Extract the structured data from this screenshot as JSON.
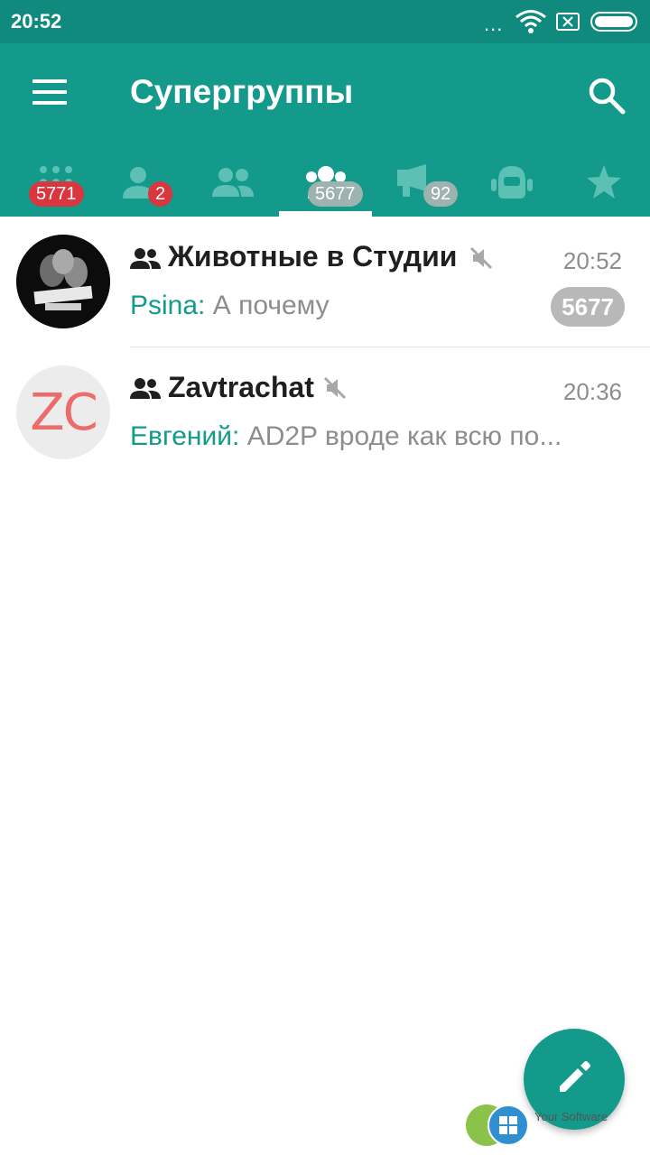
{
  "status_bar": {
    "time": "20:52",
    "dots": "..."
  },
  "app_bar": {
    "title": "Супергруппы"
  },
  "tabs": [
    {
      "icon": "all-chats-grid-icon",
      "badge": "5771",
      "badge_color": "#d9363e"
    },
    {
      "icon": "person-icon",
      "badge": "2",
      "badge_color": "#d9363e"
    },
    {
      "icon": "groups-icon",
      "badge": "",
      "badge_color": ""
    },
    {
      "icon": "supergroups-icon",
      "badge": "5677",
      "badge_color": "#9eb3b0",
      "selected": true
    },
    {
      "icon": "megaphone-icon",
      "badge": "92",
      "badge_color": "#9eb3b0"
    },
    {
      "icon": "bot-icon",
      "badge": "",
      "badge_color": ""
    },
    {
      "icon": "star-icon",
      "badge": "",
      "badge_color": ""
    }
  ],
  "chats": [
    {
      "name": "Животные в Студии",
      "time": "20:52",
      "sender": "Psina:",
      "message": "А почему",
      "unread": "5677",
      "muted": true
    },
    {
      "name": "Zavtrachat",
      "avatar_text": "ZC",
      "time": "20:36",
      "sender": "Евгений:",
      "message": "AD2P вроде как всю по...",
      "muted": true
    }
  ],
  "watermark": {
    "text": "Your Software"
  },
  "colors": {
    "primary": "#139a8b",
    "status_bar": "#0f8a7d",
    "accent_text": "#139a8b",
    "badge_red": "#d9363e",
    "badge_grey": "#9eb3b0"
  }
}
